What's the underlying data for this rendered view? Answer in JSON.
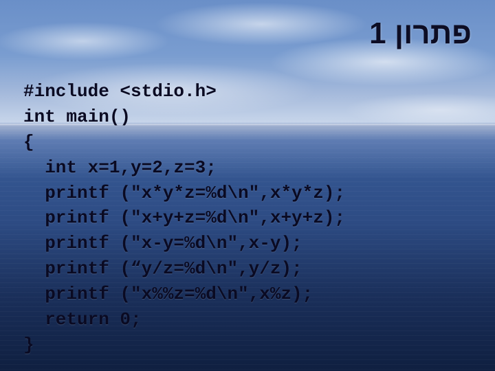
{
  "title": "פתרון 1",
  "code": {
    "line1": "#include <stdio.h>",
    "line2": "int main()",
    "line3": "{",
    "line4": "int x=1,y=2,z=3;",
    "line5": "printf (\"x*y*z=%d\\n\",x*y*z);",
    "line6": "printf (\"x+y+z=%d\\n\",x+y+z);",
    "line7": "printf (\"x-y=%d\\n\",x-y);",
    "line8": "printf (“y/z=%d\\n\",y/z);",
    "line9": "printf (\"x%%z=%d\\n\",x%z);",
    "line10": "return 0;",
    "line11": "}"
  }
}
